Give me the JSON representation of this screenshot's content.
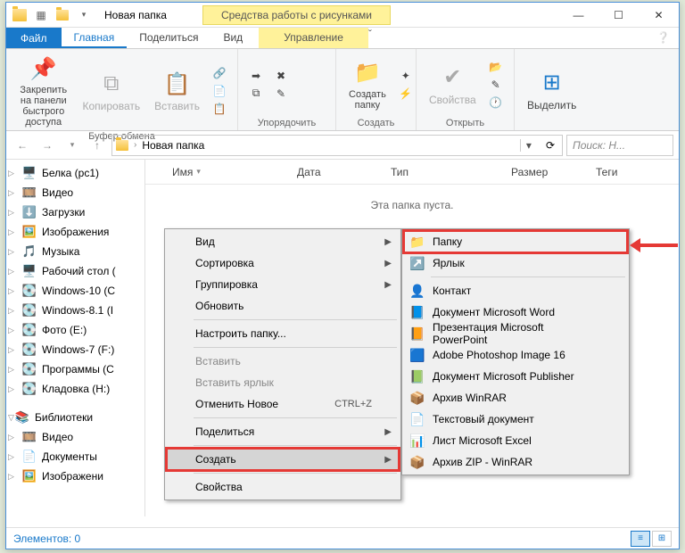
{
  "window": {
    "title": "Новая папка",
    "contextual_tools": "Средства работы с рисунками"
  },
  "ribbon_tabs": {
    "file": "Файл",
    "home": "Главная",
    "share": "Поделиться",
    "view": "Вид",
    "manage": "Управление"
  },
  "ribbon": {
    "clipboard": {
      "pin": "Закрепить на панели быстрого доступа",
      "copy": "Копировать",
      "paste": "Вставить",
      "label": "Буфер обмена"
    },
    "organize": {
      "label": "Упорядочить"
    },
    "new": {
      "folder": "Создать папку",
      "label": "Создать"
    },
    "open": {
      "props": "Свойства",
      "label": "Открыть"
    },
    "select": {
      "btn": "Выделить"
    }
  },
  "breadcrumb": {
    "path": "Новая папка"
  },
  "search": {
    "placeholder": "Поиск: Н..."
  },
  "columns": {
    "name": "Имя",
    "date": "Дата",
    "type": "Тип",
    "size": "Размер",
    "tags": "Теги"
  },
  "empty": "Эта папка пуста.",
  "status": "Элементов: 0",
  "tree": [
    {
      "icon": "🖥️",
      "label": "Белка (pc1)"
    },
    {
      "icon": "🎞️",
      "label": "Видео"
    },
    {
      "icon": "⬇️",
      "label": "Загрузки"
    },
    {
      "icon": "🖼️",
      "label": "Изображения"
    },
    {
      "icon": "🎵",
      "label": "Музыка"
    },
    {
      "icon": "🖥️",
      "label": "Рабочий стол ("
    },
    {
      "icon": "💽",
      "label": "Windows-10 (C"
    },
    {
      "icon": "💽",
      "label": "Windows-8.1 (I"
    },
    {
      "icon": "💽",
      "label": "Фото (E:)"
    },
    {
      "icon": "💽",
      "label": "Windows-7 (F:)"
    },
    {
      "icon": "💽",
      "label": "Программы (C"
    },
    {
      "icon": "💽",
      "label": "Кладовка (H:)"
    },
    {
      "icon": "📚",
      "label": "Библиотеки",
      "lib": true
    },
    {
      "icon": "🎞️",
      "label": "Видео"
    },
    {
      "icon": "📄",
      "label": "Документы"
    },
    {
      "icon": "🖼️",
      "label": "Изображени"
    }
  ],
  "ctx1": [
    {
      "label": "Вид",
      "arrow": true
    },
    {
      "label": "Сортировка",
      "arrow": true
    },
    {
      "label": "Группировка",
      "arrow": true
    },
    {
      "label": "Обновить"
    },
    {
      "sep": true
    },
    {
      "label": "Настроить папку..."
    },
    {
      "sep": true
    },
    {
      "label": "Вставить",
      "disabled": true
    },
    {
      "label": "Вставить ярлык",
      "disabled": true
    },
    {
      "label": "Отменить Новое",
      "shortcut": "CTRL+Z"
    },
    {
      "sep": true
    },
    {
      "label": "Поделиться",
      "arrow": true
    },
    {
      "sep": true
    },
    {
      "label": "Создать",
      "arrow": true,
      "hover": true,
      "highlight": true
    },
    {
      "sep": true
    },
    {
      "label": "Свойства"
    }
  ],
  "ctx2": [
    {
      "icon": "📁",
      "label": "Папку",
      "highlight": true
    },
    {
      "icon": "↗️",
      "label": "Ярлык"
    },
    {
      "sep": true
    },
    {
      "icon": "👤",
      "label": "Контакт"
    },
    {
      "icon": "📘",
      "label": "Документ Microsoft Word"
    },
    {
      "icon": "📙",
      "label": "Презентация Microsoft PowerPoint"
    },
    {
      "icon": "🟦",
      "label": "Adobe Photoshop Image 16"
    },
    {
      "icon": "📗",
      "label": "Документ Microsoft Publisher"
    },
    {
      "icon": "📦",
      "label": "Архив WinRAR"
    },
    {
      "icon": "📄",
      "label": "Текстовый документ"
    },
    {
      "icon": "📊",
      "label": "Лист Microsoft Excel"
    },
    {
      "icon": "📦",
      "label": "Архив ZIP - WinRAR"
    }
  ]
}
